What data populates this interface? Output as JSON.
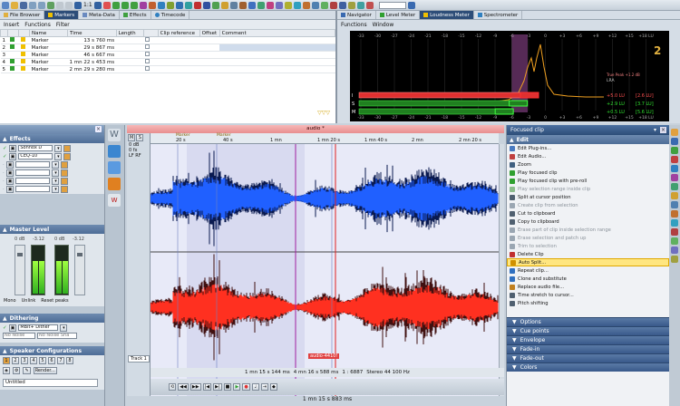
{
  "toolbar": {
    "zoom_value": "1:1"
  },
  "left_tabs": [
    "File Browser",
    "Markers",
    "Meta-Data",
    "Effects",
    "Timecode"
  ],
  "left_menu": [
    "Insert",
    "Functions",
    "Filter"
  ],
  "marker_table": {
    "headers": [
      "Name",
      "Time",
      "Length",
      "Clip reference",
      "Offset",
      "Comment"
    ],
    "rows": [
      {
        "num": "1",
        "name": "Marker",
        "time": "13 s 760 ms"
      },
      {
        "num": "2",
        "name": "Marker",
        "time": "29 s 867 ms"
      },
      {
        "num": "3",
        "name": "Marker",
        "time": "46 s 667 ms"
      },
      {
        "num": "4",
        "name": "Marker",
        "time": "1 mn 22 s 453 ms"
      },
      {
        "num": "5",
        "name": "Marker",
        "time": "2 mn 29 s 280 ms"
      }
    ]
  },
  "right_tabs": [
    "Navigator",
    "Level Meter",
    "Loudness Meter",
    "Spectrometer"
  ],
  "right_menu": [
    "Functions",
    "Window"
  ],
  "loudness": {
    "scale": [
      "-33",
      "-30",
      "-27",
      "-24",
      "-21",
      "-18",
      "-15",
      "-12",
      "-9",
      "-6",
      "-3",
      "0",
      "+3",
      "+6",
      "+9",
      "+12",
      "+15",
      "+18 LU"
    ],
    "rows": [
      {
        "label": "I",
        "lu": "+5.0 LU",
        "max": "[2.6 LU]",
        "fill": 0.64
      },
      {
        "label": "S",
        "lu": "+2.9 LU",
        "max": "[3.7 LU]",
        "fill": 0.6
      },
      {
        "label": "M",
        "lu": "+0.5 LU",
        "max": "[5.6 LU]",
        "fill": 0.55
      }
    ],
    "lra_label": "LRA",
    "true_peak": "True Peak +1.2 dB",
    "logo": "2"
  },
  "left_panel": {
    "effects_title": "Effects",
    "slots": [
      "Sonnox D",
      "CEQ-10",
      "",
      "",
      "",
      ""
    ],
    "master_title": "Master Level",
    "mono_label": "Mono",
    "unlink_label": "Unlink",
    "reset_label": "Reset peaks",
    "meter_values": [
      "0 dB",
      "-3.12",
      "0 dB",
      "-3.12"
    ],
    "dithering_title": "Dithering",
    "dither_slot": "MBit+ Dither",
    "no_noise_1": "No Noise",
    "no_noise_2": "No Noise Sha",
    "speaker_title": "Speaker Configurations",
    "speaker_nums": [
      "1",
      "2",
      "3",
      "4",
      "5",
      "6",
      "7",
      "8"
    ],
    "render_label": "Render...",
    "untitled_label": "Untitled"
  },
  "wave": {
    "title": "audio *",
    "track_label": "Track 1",
    "clip_label": "audio-4410!",
    "db_label": "0 dB",
    "fx_label": "0 fx",
    "lr_label": "LF RF",
    "markers": [
      "Marker",
      "Marker"
    ],
    "ruler": [
      "20 s",
      "40 s",
      "1 mn",
      "1 mn 20 s",
      "1 mn 40 s",
      "2 mn",
      "2 mn 20 s"
    ]
  },
  "status": {
    "time1": "1 mn 15 s 144 ms",
    "time2": "4 mn 16 s 588 ms",
    "ratio": "1 : 6887",
    "format": "Stereo 44 100 Hz",
    "position": "1 mn 15 s 883 ms"
  },
  "focused_clip": {
    "title": "Focused clip",
    "edit_label": "Edit",
    "items": [
      {
        "label": "Edit Plug-ins...",
        "color": "#4a7ac0",
        "state": "normal"
      },
      {
        "label": "Edit Audio...",
        "color": "#c04040",
        "state": "normal"
      },
      {
        "label": "Zoom",
        "color": "#406080",
        "state": "normal"
      },
      {
        "label": "Play focused clip",
        "color": "#30a030",
        "state": "normal"
      },
      {
        "label": "Play focused clip with pre-roll",
        "color": "#30a030",
        "state": "normal"
      },
      {
        "label": "Play selection range inside clip",
        "color": "#8cbc8c",
        "state": "disabled"
      },
      {
        "label": "Split at cursor position",
        "color": "#506070",
        "state": "normal"
      },
      {
        "label": "Create clip from selection",
        "color": "#9aa6b2",
        "state": "disabled"
      },
      {
        "label": "Cut to clipboard",
        "color": "#506070",
        "state": "normal"
      },
      {
        "label": "Copy to clipboard",
        "color": "#506070",
        "state": "normal"
      },
      {
        "label": "Erase part of clip inside selection range",
        "color": "#9aa6b2",
        "state": "disabled"
      },
      {
        "label": "Erase selection and patch up",
        "color": "#9aa6b2",
        "state": "disabled"
      },
      {
        "label": "Trim to selection",
        "color": "#9aa6b2",
        "state": "disabled"
      },
      {
        "label": "Delete Clip",
        "color": "#c03030",
        "state": "normal"
      },
      {
        "label": "Auto Split...",
        "color": "#d09000",
        "state": "highlight"
      },
      {
        "label": "Repeat clip...",
        "color": "#3070c0",
        "state": "normal"
      },
      {
        "label": "Clone and substitute",
        "color": "#3070c0",
        "state": "normal"
      },
      {
        "label": "Replace audio file...",
        "color": "#c08020",
        "state": "normal"
      },
      {
        "label": "Time stretch to cursor...",
        "color": "#506070",
        "state": "normal"
      },
      {
        "label": "Pitch shifting",
        "color": "#506070",
        "state": "normal"
      }
    ],
    "sections": [
      "Options",
      "Cue points",
      "Envelope",
      "Fade-in",
      "Fade-out",
      "Colors"
    ]
  }
}
